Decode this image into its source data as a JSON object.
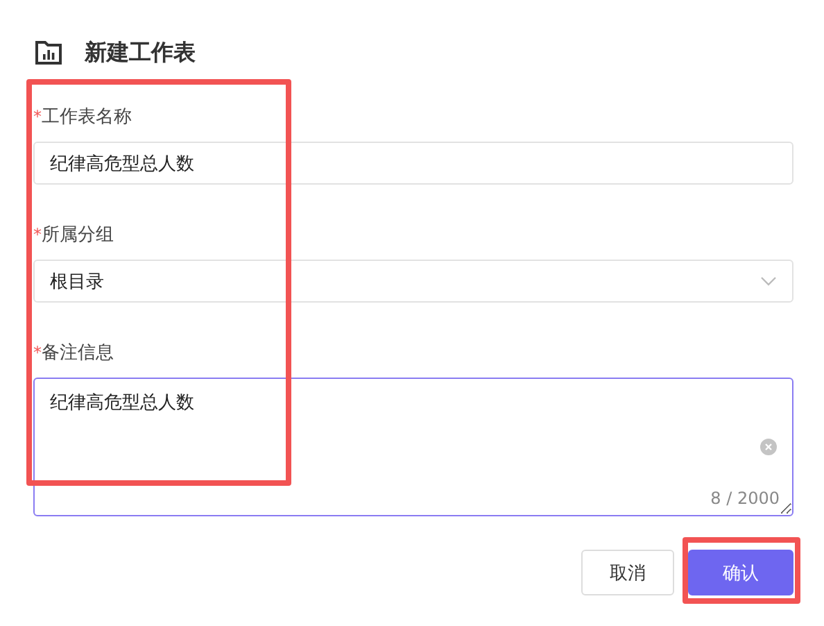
{
  "dialog": {
    "title": "新建工作表"
  },
  "form": {
    "highlighted": true
  },
  "fields": [
    {
      "kind": "input",
      "required_mark": "*",
      "label": "工作表名称",
      "value": "纪律高危型总人数",
      "focused": false
    },
    {
      "kind": "select",
      "required_mark": "*",
      "label": "所属分组",
      "value": "根目录",
      "focused": false
    },
    {
      "kind": "textarea",
      "required_mark": "*",
      "label": "备注信息",
      "value": "纪律高危型总人数",
      "focused": true,
      "counter": "8 / 2000"
    }
  ],
  "buttons": [
    {
      "label": "取消",
      "kind": "default",
      "highlighted": false
    },
    {
      "label": "确认",
      "kind": "primary",
      "highlighted": true
    }
  ]
}
